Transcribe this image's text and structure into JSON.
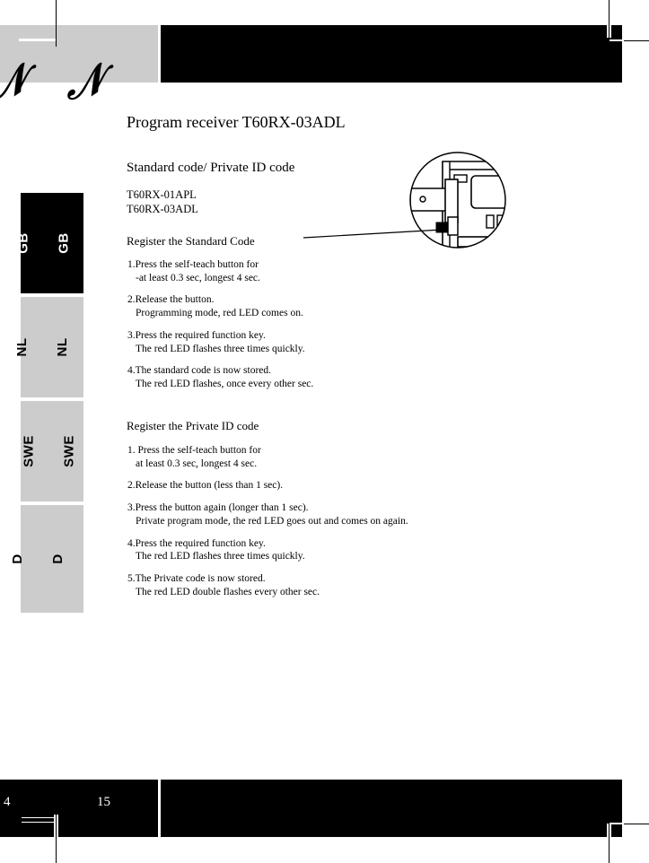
{
  "document": {
    "page_numbers": {
      "left": "4",
      "right": "15"
    }
  },
  "colors": {
    "bar_black": "#000000",
    "tab_gray": "#cccccc",
    "active_tab_bg": "#000000",
    "active_tab_text": "#ffffff",
    "page_background": "#ffffff"
  },
  "language_tabs": [
    {
      "label": "GB",
      "active": true
    },
    {
      "label": "NL",
      "active": false
    },
    {
      "label": "SWE",
      "active": false
    },
    {
      "label": "D",
      "active": false
    }
  ],
  "content": {
    "title": "Program receiver T60RX-03ADL",
    "subtitle": "Standard code/ Private ID code",
    "models": [
      "T60RX-01APL",
      "T60RX-03ADL"
    ],
    "standard_section": {
      "heading": "Register the Standard Code",
      "steps": [
        {
          "line1": "1.Press the self-teach button for",
          "line2": "-at least 0.3 sec, longest 4 sec."
        },
        {
          "line1": "2.Release the button.",
          "line2": "Programming mode, red LED comes on."
        },
        {
          "line1": "3.Press the required function key.",
          "line2": "The red LED flashes three times quickly."
        },
        {
          "line1": "4.The standard code is now stored.",
          "line2": "The red LED flashes, once every other sec."
        }
      ]
    },
    "private_section": {
      "heading": "Register the Private ID code",
      "steps": [
        {
          "line1": "1. Press the self-teach button for",
          "line2": "at least 0.3 sec, longest 4 sec."
        },
        {
          "line1": "2.Release the button (less than 1 sec).",
          "line2": ""
        },
        {
          "line1": "3.Press the button again (longer than 1 sec).",
          "line2": "Private program mode, the red LED goes out and comes on again."
        },
        {
          "line1": "4.Press the required function key.",
          "line2": "The red LED flashes three times quickly."
        },
        {
          "line1": "5.The Private code is now stored.",
          "line2": "The red LED double flashes every other sec."
        }
      ]
    }
  },
  "illustration": {
    "name": "receiver-detail-callout",
    "description": "Circular magnified view of receiver module with self-teach button"
  },
  "header_marks": {
    "scribble_1": "𝒩",
    "scribble_2": "𝒩"
  }
}
